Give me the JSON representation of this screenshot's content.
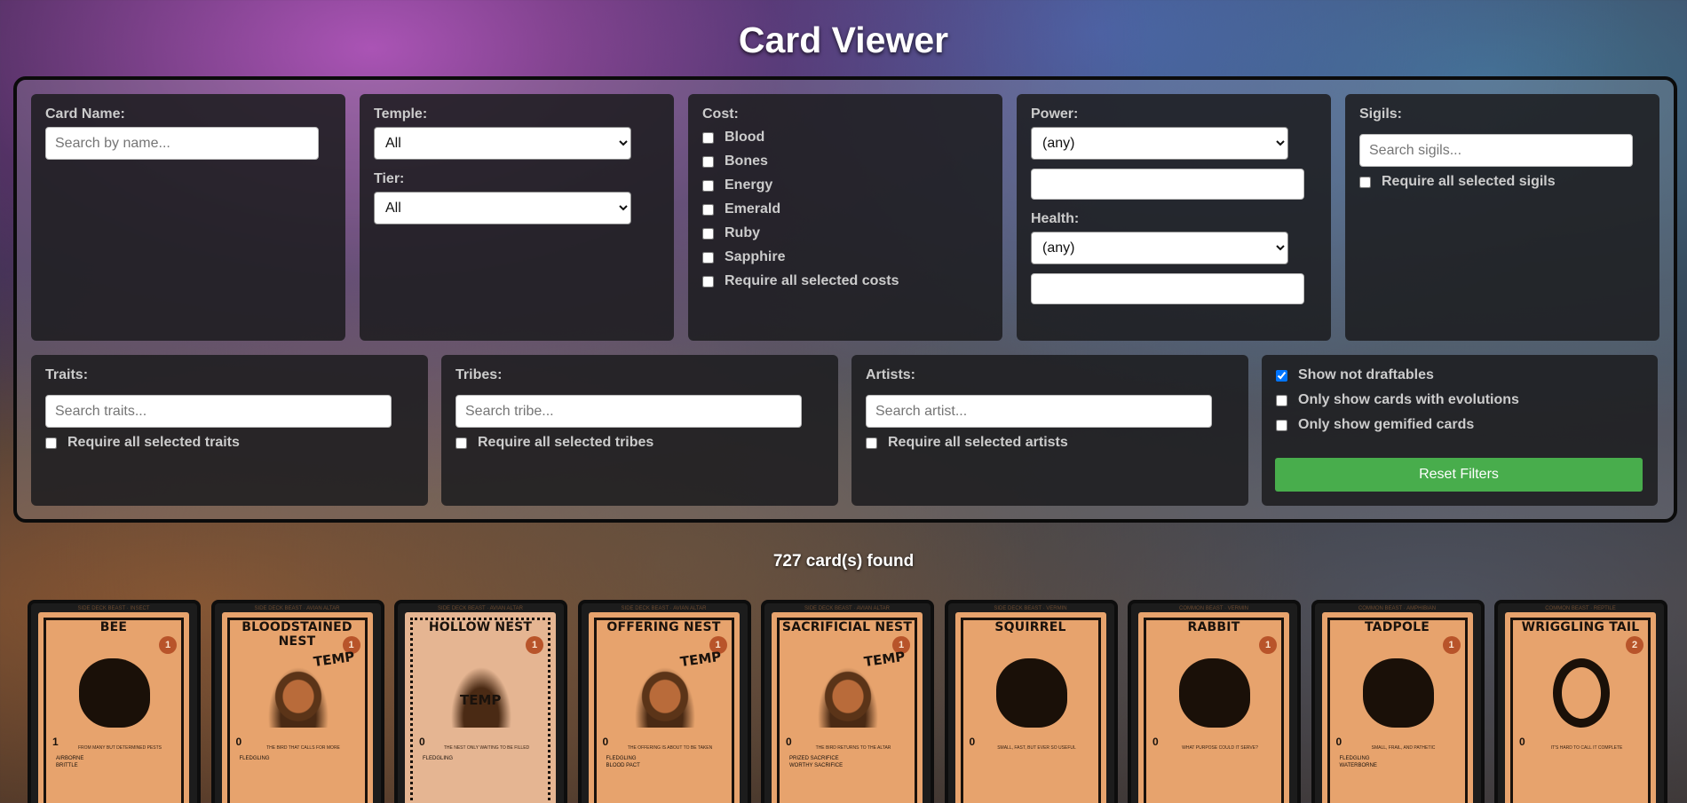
{
  "page": {
    "title": "Card Viewer"
  },
  "filters": {
    "card_name": {
      "label": "Card Name:",
      "placeholder": "Search by name..."
    },
    "temple": {
      "label": "Temple:",
      "value": "All"
    },
    "tier": {
      "label": "Tier:",
      "value": "All"
    },
    "cost": {
      "label": "Cost:",
      "options": [
        "Blood",
        "Bones",
        "Energy",
        "Emerald",
        "Ruby",
        "Sapphire"
      ],
      "require_all": "Require all selected costs"
    },
    "power": {
      "label": "Power:",
      "value": "(any)"
    },
    "health": {
      "label": "Health:",
      "value": "(any)"
    },
    "sigils": {
      "label": "Sigils:",
      "placeholder": "Search sigils...",
      "require_all": "Require all selected sigils"
    },
    "traits": {
      "label": "Traits:",
      "placeholder": "Search traits...",
      "require_all": "Require all selected traits"
    },
    "tribes": {
      "label": "Tribes:",
      "placeholder": "Search tribe...",
      "require_all": "Require all selected tribes"
    },
    "artists": {
      "label": "Artists:",
      "placeholder": "Search artist...",
      "require_all": "Require all selected artists"
    },
    "toggles": {
      "show_not_draftables": {
        "label": "Show not draftables",
        "checked": true
      },
      "only_evolutions": {
        "label": "Only show cards with evolutions",
        "checked": false
      },
      "only_gemified": {
        "label": "Only show gemified cards",
        "checked": false
      }
    },
    "reset_label": "Reset Filters",
    "accent_color": "#48ad4c"
  },
  "results": {
    "count_text": "727 card(s) found"
  },
  "cards": [
    {
      "name": "BEE",
      "subtitle": "SIDE DECK BEAST · INSECT",
      "cost": "1",
      "power": "1",
      "desc": "FROM MANY BUT DETERMINED PESTS",
      "sigils": [
        "AIRBORNE",
        "BRITTLE"
      ],
      "art": "bug",
      "temp": ""
    },
    {
      "name": "BLOODSTAINED NEST",
      "subtitle": "SIDE DECK BEAST · AVIAN ALTAR",
      "cost": "1",
      "power": "0",
      "desc": "THE BIRD THAT CALLS FOR MORE",
      "sigils": [
        "FLEDGLING"
      ],
      "art": "egg",
      "temp": "TEMP"
    },
    {
      "name": "HOLLOW NEST",
      "subtitle": "SIDE DECK BEAST · AVIAN ALTAR",
      "cost": "1",
      "power": "0",
      "desc": "THE NEST ONLY WAITING TO BE FILLED",
      "sigils": [
        "FLEDGLING"
      ],
      "art": "nest",
      "temp": "TEMP"
    },
    {
      "name": "OFFERING NEST",
      "subtitle": "SIDE DECK BEAST · AVIAN ALTAR",
      "cost": "1",
      "power": "0",
      "desc": "THE OFFERING IS ABOUT TO BE TAKEN",
      "sigils": [
        "FLEDGLING",
        "BLOOD PACT"
      ],
      "art": "egg",
      "temp": "TEMP"
    },
    {
      "name": "SACRIFICIAL NEST",
      "subtitle": "SIDE DECK BEAST · AVIAN ALTAR",
      "cost": "1",
      "power": "0",
      "desc": "THE BIRD RETURNS TO THE ALTAR",
      "sigils": [
        "PRIZED SACRIFICE",
        "WORTHY SACRIFICE"
      ],
      "art": "egg",
      "temp": "TEMP"
    },
    {
      "name": "SQUIRREL",
      "subtitle": "SIDE DECK BEAST · VERMIN",
      "cost": "",
      "power": "0",
      "desc": "SMALL, FAST, BUT EVER SO USEFUL",
      "sigils": [],
      "art": "squirrel",
      "temp": ""
    },
    {
      "name": "RABBIT",
      "subtitle": "COMMON BEAST · VERMIN",
      "cost": "1",
      "power": "0",
      "desc": "WHAT PURPOSE COULD IT SERVE?",
      "sigils": [],
      "art": "rabbit",
      "temp": ""
    },
    {
      "name": "TADPOLE",
      "subtitle": "COMMON BEAST · AMPHIBIAN",
      "cost": "1",
      "power": "0",
      "desc": "SMALL, FRAIL, AND PATHETIC",
      "sigils": [
        "FLEDGLING",
        "WATERBORNE"
      ],
      "art": "tadpole",
      "temp": ""
    },
    {
      "name": "WRIGGLING TAIL",
      "subtitle": "COMMON BEAST · REPTILE",
      "cost": "2",
      "power": "0",
      "desc": "IT'S HARD TO CALL IT COMPLETE",
      "sigils": [],
      "art": "snake",
      "temp": ""
    }
  ]
}
